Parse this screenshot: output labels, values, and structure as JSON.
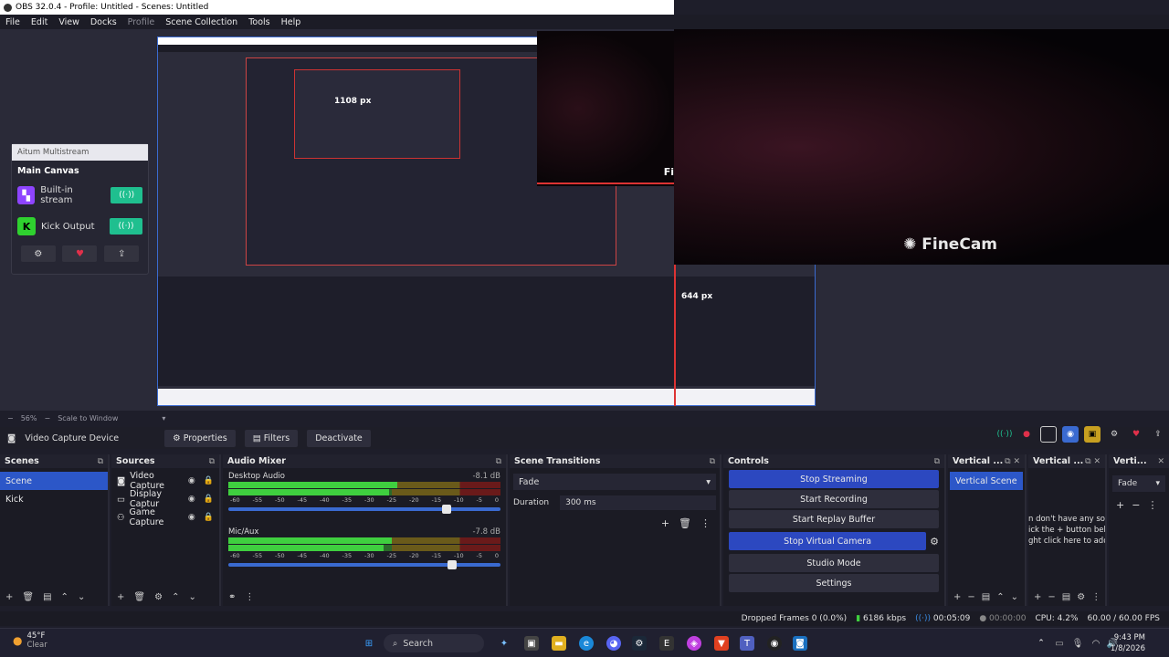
{
  "window": {
    "title": "OBS 32.0.4 - Profile: Untitled - Scenes: Untitled"
  },
  "menu": {
    "items": [
      "File",
      "Edit",
      "View",
      "Docks",
      "Profile",
      "Scene Collection",
      "Tools",
      "Help"
    ]
  },
  "preview": {
    "camera_logo": "FineCam",
    "nested_camera_logo": "Fi",
    "width_label": "1108 px",
    "height_label": "644 px"
  },
  "multistream": {
    "header": "Aitum Multistream",
    "title": "Main Canvas",
    "rows": [
      {
        "label": "Built-in stream",
        "icon": "twitch-icon",
        "color": "#8e44ff"
      },
      {
        "label": "Kick Output",
        "icon": "kick-icon",
        "color": "#2fd12f"
      }
    ]
  },
  "scalebar": {
    "zoom": "56%",
    "mode": "Scale to Window"
  },
  "source_toolbar": {
    "source_name": "Video Capture Device",
    "properties": "Properties",
    "filters": "Filters",
    "deactivate": "Deactivate"
  },
  "scenes": {
    "title": "Scenes",
    "items": [
      "Scene",
      "Kick"
    ]
  },
  "sources": {
    "title": "Sources",
    "items": [
      "Video Capture",
      "Display Captur",
      "Game Capture"
    ]
  },
  "audio_mixer": {
    "title": "Audio Mixer",
    "ticks": [
      "-60",
      "-55",
      "-50",
      "-45",
      "-40",
      "-35",
      "-30",
      "-25",
      "-20",
      "-15",
      "-10",
      "-5",
      "0"
    ],
    "channels": [
      {
        "name": "Desktop Audio",
        "db": "-8.1 dB",
        "level": 0.62,
        "volume": 0.82
      },
      {
        "name": "Mic/Aux",
        "db": "-7.8 dB",
        "level": 0.6,
        "volume": 0.84
      }
    ]
  },
  "transitions": {
    "title": "Scene Transitions",
    "selected": "Fade",
    "duration_label": "Duration",
    "duration_value": "300 ms"
  },
  "controls": {
    "title": "Controls",
    "buttons": [
      "Stop Streaming",
      "Start Recording",
      "Start Replay Buffer",
      "Stop Virtual Camera",
      "Studio Mode",
      "Settings"
    ]
  },
  "vertical": {
    "title1": "Vertical ...",
    "title2": "Vertical ...",
    "title3": "Verti...",
    "scene": "Vertical Scene",
    "hint_lines": [
      "n don't have any sour",
      "ick the + button belc",
      "ght click here to add"
    ],
    "transition": "Fade"
  },
  "status": {
    "dropped": "Dropped Frames 0 (0.0%)",
    "kbps": "6186 kbps",
    "stream_time": "00:05:09",
    "rec_time": "00:00:00",
    "cpu": "CPU: 4.2%",
    "fps": "60.00 / 60.00 FPS"
  },
  "taskbar": {
    "temp": "45°F",
    "weather": "Clear",
    "search": "Search",
    "time": "9:43 PM",
    "date": "1/8/2026"
  },
  "colors": {
    "accent": "#2c48c0",
    "selection": "#2c57c8",
    "stream_green": "#1fbf8f"
  }
}
